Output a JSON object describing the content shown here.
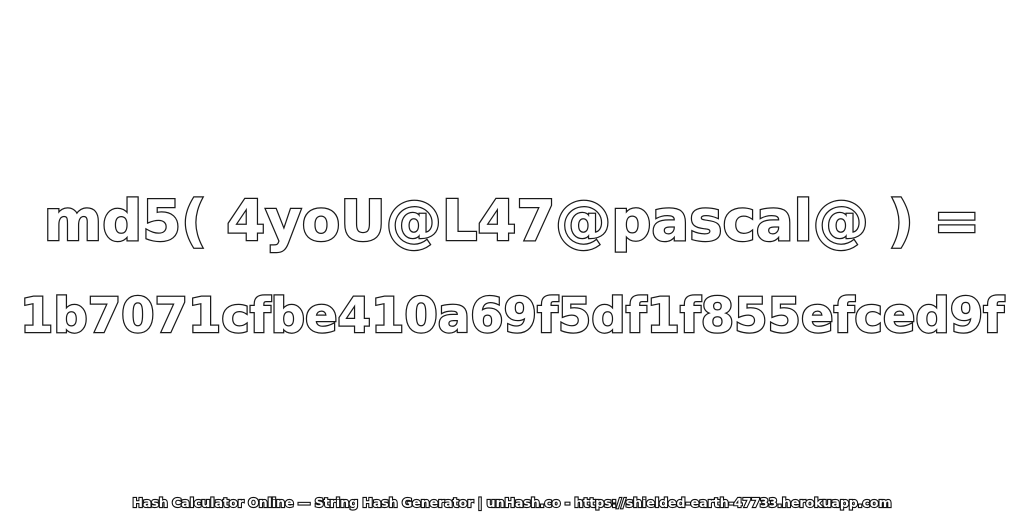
{
  "expression": {
    "text": "md5( 4yoU@L47@pascal@ ) ="
  },
  "result": {
    "hash": "1b7071cfbe410a69f5df1f855efced9f"
  },
  "footer": {
    "text": "Hash Calculator Online — String Hash Generator | unHash.co - https://shielded-earth-47733.herokuapp.com"
  },
  "colors": {
    "background": "#ffffff",
    "text_fill": "#ffffff",
    "text_outline": "#1a1a1a"
  }
}
